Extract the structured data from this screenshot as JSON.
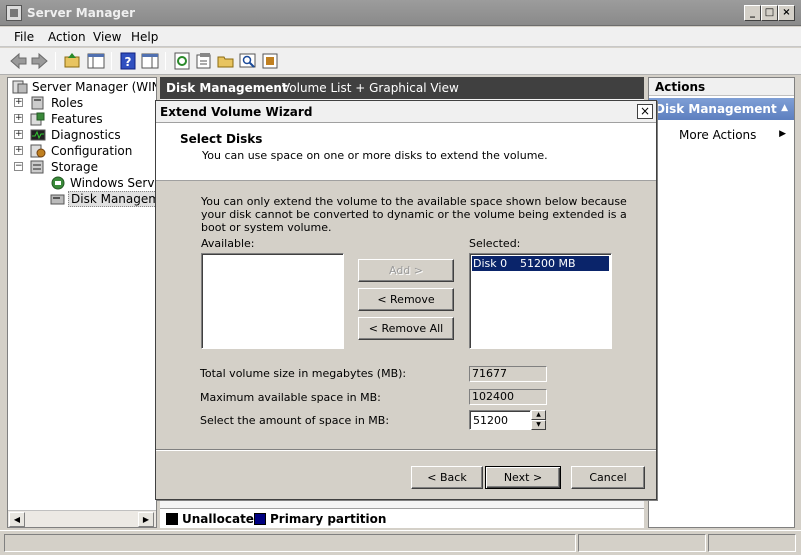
{
  "window": {
    "title": "Server Manager",
    "min": "_",
    "max": "□",
    "close": "×"
  },
  "menu": [
    "File",
    "Action",
    "View",
    "Help"
  ],
  "tree": {
    "root": "Server Manager (WIN-AD",
    "items": [
      {
        "label": "Roles",
        "expander": "+"
      },
      {
        "label": "Features",
        "expander": "+"
      },
      {
        "label": "Diagnostics",
        "expander": "+"
      },
      {
        "label": "Configuration",
        "expander": "+"
      },
      {
        "label": "Storage",
        "expander": "−"
      }
    ],
    "children": [
      {
        "label": "Windows Server B"
      },
      {
        "label": "Disk Management"
      }
    ]
  },
  "center": {
    "header_title": "Disk Management",
    "header_view": "Volume List + Graphical View",
    "legend": [
      {
        "label": "Unallocated",
        "color": "#000000"
      },
      {
        "label": "Primary partition",
        "color": "#000080"
      }
    ]
  },
  "actions": {
    "title": "Actions",
    "section": "Disk Management",
    "section_collapse": "▲",
    "more": "More Actions",
    "more_arrow": "▶"
  },
  "dialog": {
    "title": "Extend Volume Wizard",
    "close": "×",
    "heading": "Select Disks",
    "subheading": "You can use space on one or more disks to extend the volume.",
    "info": "You can only extend the volume to the available space shown below because your disk cannot be converted to dynamic or the volume being extended is a boot or system volume.",
    "available_label": "Available:",
    "selected_label": "Selected:",
    "selected_items": [
      {
        "disk": "Disk 0",
        "size": "51200 MB"
      }
    ],
    "add_button": "Add >",
    "remove_button": "< Remove",
    "remove_all_button": "< Remove All",
    "total_label": "Total volume size in megabytes (MB):",
    "total_value": "71677",
    "max_label": "Maximum available space in MB:",
    "max_value": "102400",
    "amount_label": "Select the amount of space in MB:",
    "amount_value": "51200",
    "back_button": "< Back",
    "next_button": "Next >",
    "cancel_button": "Cancel"
  }
}
